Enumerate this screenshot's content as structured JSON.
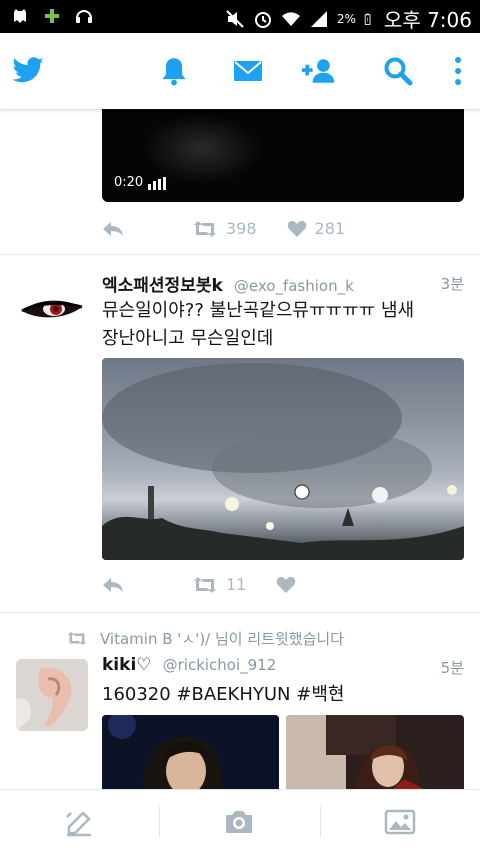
{
  "status_bar": {
    "battery_percent": "2%",
    "time": "오후 7:06",
    "icons": [
      "ghost-icon",
      "plus-icon",
      "headphones-icon",
      "mute-icon",
      "alarm-icon",
      "wifi-icon",
      "signal-icon",
      "battery-icon"
    ]
  },
  "app_bar": {
    "icons": [
      "twitter-bird-icon",
      "bell-icon",
      "mail-icon",
      "add-user-icon",
      "search-icon",
      "more-icon"
    ],
    "accent": "#1da1f2"
  },
  "tweets": [
    {
      "video": {
        "duration": "0:20"
      },
      "retweets": "398",
      "likes": "281"
    },
    {
      "name": "엑소패션정보봇k",
      "handle": "@exo_fashion_k",
      "time": "3분",
      "text_line1": "뮤슨일이야?? 불난곡같으뮤ㅠㅠㅠㅠ 냄새",
      "text_line2": "장난아니고 무슨일인데",
      "retweets": "11",
      "likes": ""
    },
    {
      "retweeted_by": "Vitamin B 'ㅅ')/ 님이 리트윗했습니다",
      "name": "kiki♡",
      "handle": "@rickichoi_912",
      "time": "5분",
      "text": "160320 #BAEKHYUN #백현"
    }
  ],
  "bottom_bar": {
    "icons": [
      "compose-icon",
      "camera-icon",
      "gallery-icon"
    ]
  },
  "colors": {
    "action_gray": "#aab8c2",
    "text": "#14171a",
    "secondary": "#8899a6"
  }
}
